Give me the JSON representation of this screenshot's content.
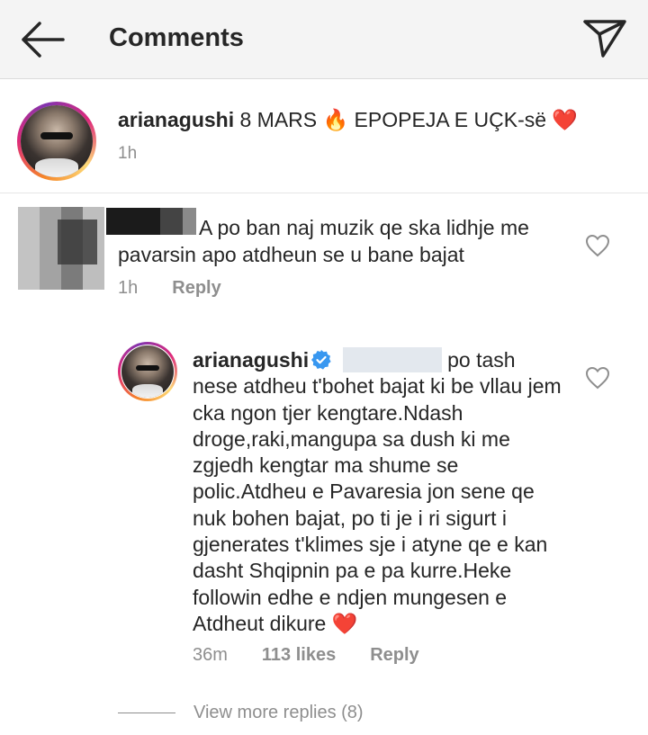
{
  "header": {
    "title": "Comments",
    "back_icon": "arrow-left-icon",
    "send_icon": "paper-plane-icon"
  },
  "caption": {
    "username": "arianagushi",
    "text_a": " 8 MARS ",
    "fire_emoji": "🔥",
    "text_b": " EPOPEJA E UÇK-së ",
    "heart_emoji": "❤️",
    "time": "1h"
  },
  "comment1": {
    "text": "A po ban naj muzik qe ska lidhje me pavarsin apo atdheun se u bane  bajat",
    "time": "1h",
    "reply_label": "Reply"
  },
  "reply1": {
    "username": "arianagushi",
    "text": "po tash nese atdheu t'bohet bajat ki be vllau jem cka ngon tjer kengtare.Ndash droge,raki,mangupa sa dush ki me zgjedh kengtar ma shume se polic.Atdheu e Pavaresia jon sene qe nuk bohen bajat, po ti je i ri sigurt i gjenerates t'klimes sje i atyne qe e kan dasht Shqipnin pa e pa kurre.Heke followin edhe e ndjen mungesen e Atdheut dikure ",
    "heart_emoji": "❤️",
    "time": "36m",
    "likes": "113 likes",
    "reply_label": "Reply"
  },
  "view_more": "View more replies (8)",
  "colors": {
    "text": "#262626",
    "muted": "#8e8e8e",
    "verified": "#3897f0",
    "heart": "#ed4956",
    "header_bg": "#f4f4f4"
  }
}
